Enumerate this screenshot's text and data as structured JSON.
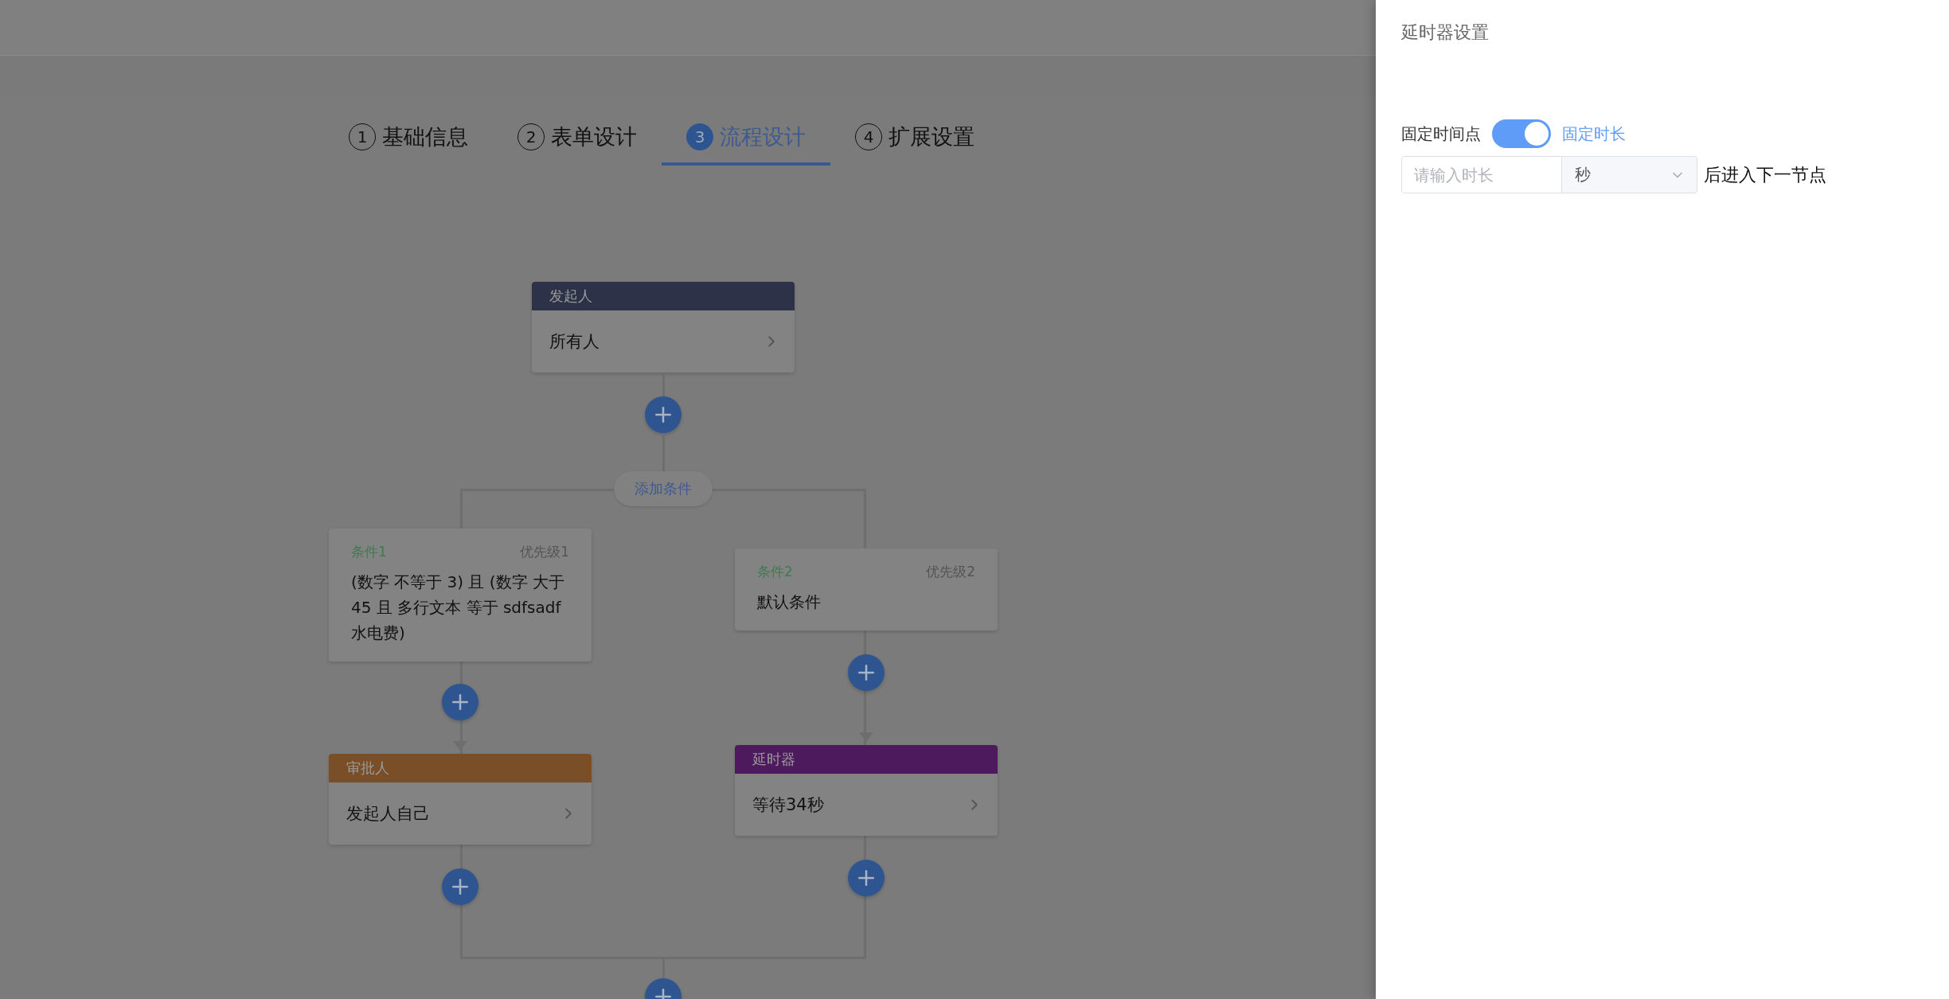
{
  "steps": [
    {
      "number": "1",
      "label": "基础信息",
      "selected": false
    },
    {
      "number": "2",
      "label": "表单设计",
      "selected": false
    },
    {
      "number": "3",
      "label": "流程设计",
      "selected": true
    },
    {
      "number": "4",
      "label": "扩展设置",
      "selected": false
    }
  ],
  "flow": {
    "start": {
      "kind": "start",
      "header": "发起人",
      "content": "所有人"
    },
    "add_condition": "添加条件",
    "branches": [
      {
        "condition": {
          "title": "条件1",
          "priority": "优先级1",
          "text": "(数字 不等于 3) 且 (数字 大于 45 且 多行文本 等于 sdfsadf 水电费)"
        },
        "node": {
          "kind": "approver",
          "header": "审批人",
          "content": "发起人自己"
        }
      },
      {
        "condition": {
          "title": "条件2",
          "priority": "优先级2",
          "text": "默认条件"
        },
        "node": {
          "kind": "delay",
          "header": "延时器",
          "content": "等待34秒"
        }
      }
    ]
  },
  "drawer": {
    "title": "延时器设置",
    "mode_off_label": "固定时间点",
    "mode_switch_on": true,
    "mode_on_label": "固定时长",
    "duration": {
      "placeholder": "请输入时长"
    },
    "unit": "秒",
    "suffix": "后进入下一节点"
  }
}
